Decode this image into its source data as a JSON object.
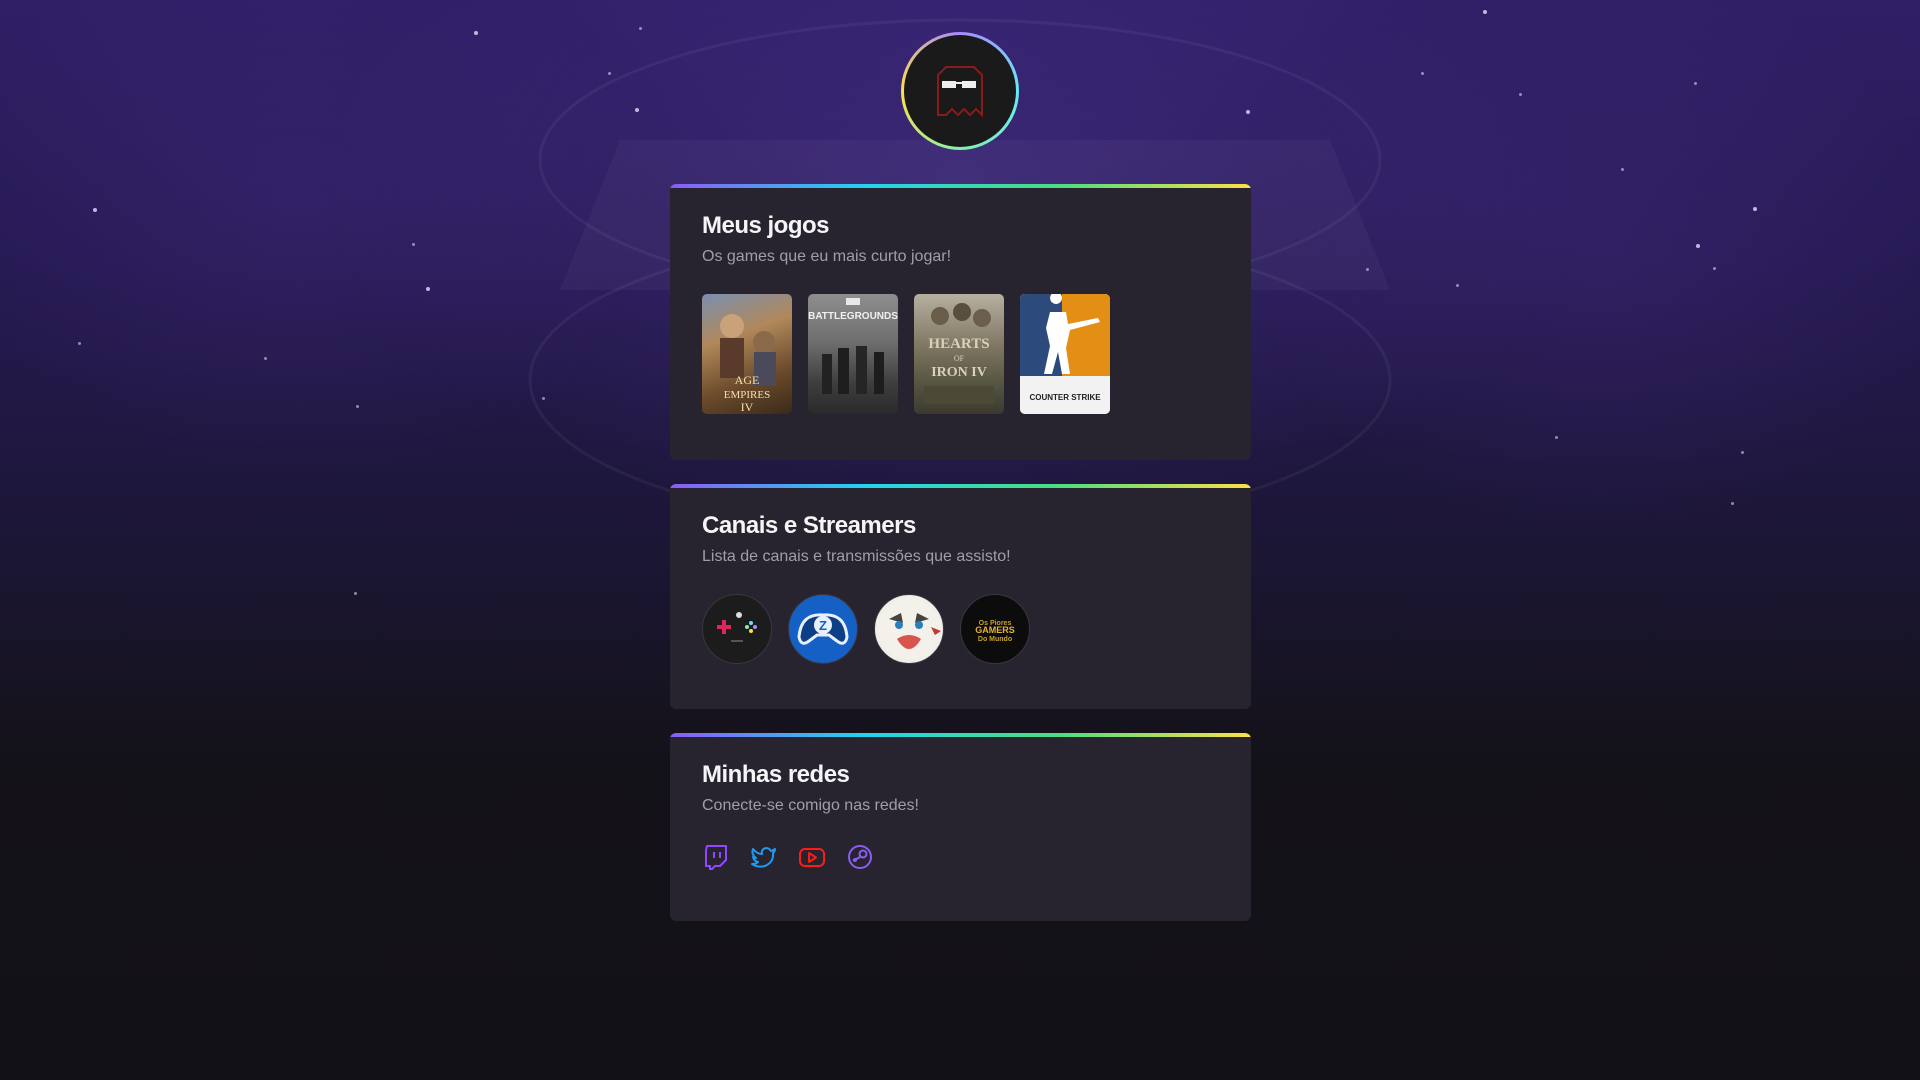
{
  "profile": {
    "avatar_alt": "Avatar",
    "ring_colors": [
      "#a78bfa",
      "#67e8f9",
      "#86efac",
      "#fde047"
    ]
  },
  "games_section": {
    "title": "Meus jogos",
    "subtitle": "Os games que eu mais curto jogar!",
    "games": [
      {
        "name": "Age of Empires IV",
        "icon": "age-of-empires-iv-cover"
      },
      {
        "name": "PUBG Battlegrounds",
        "icon": "pubg-battlegrounds-cover"
      },
      {
        "name": "Hearts of Iron IV",
        "icon": "hearts-of-iron-iv-cover"
      },
      {
        "name": "Counter Strike",
        "icon": "counter-strike-cover"
      }
    ]
  },
  "channels_section": {
    "title": "Canais e Streamers",
    "subtitle": "Lista de canais e transmissões que assisto!",
    "channels": [
      {
        "icon": "gamepad-channel-avatar"
      },
      {
        "icon": "blue-controller-channel-avatar"
      },
      {
        "icon": "cat-face-channel-avatar"
      },
      {
        "icon": "gamers-channel-avatar"
      }
    ]
  },
  "socials_section": {
    "title": "Minhas redes",
    "subtitle": "Conecte-se comigo nas redes!",
    "links": [
      {
        "name": "Twitch",
        "icon": "twitch-icon",
        "color": "#9146ff"
      },
      {
        "name": "Twitter",
        "icon": "twitter-icon",
        "color": "#1d9bf0"
      },
      {
        "name": "YouTube",
        "icon": "youtube-icon",
        "color": "#ff0000"
      },
      {
        "name": "Steam",
        "icon": "steam-icon",
        "color": "#8b5cf6"
      }
    ]
  },
  "colors": {
    "card_bg": "#28242f",
    "accent_gradient": [
      "#8b5cf6",
      "#22d3ee",
      "#4ade80",
      "#fde047"
    ]
  }
}
